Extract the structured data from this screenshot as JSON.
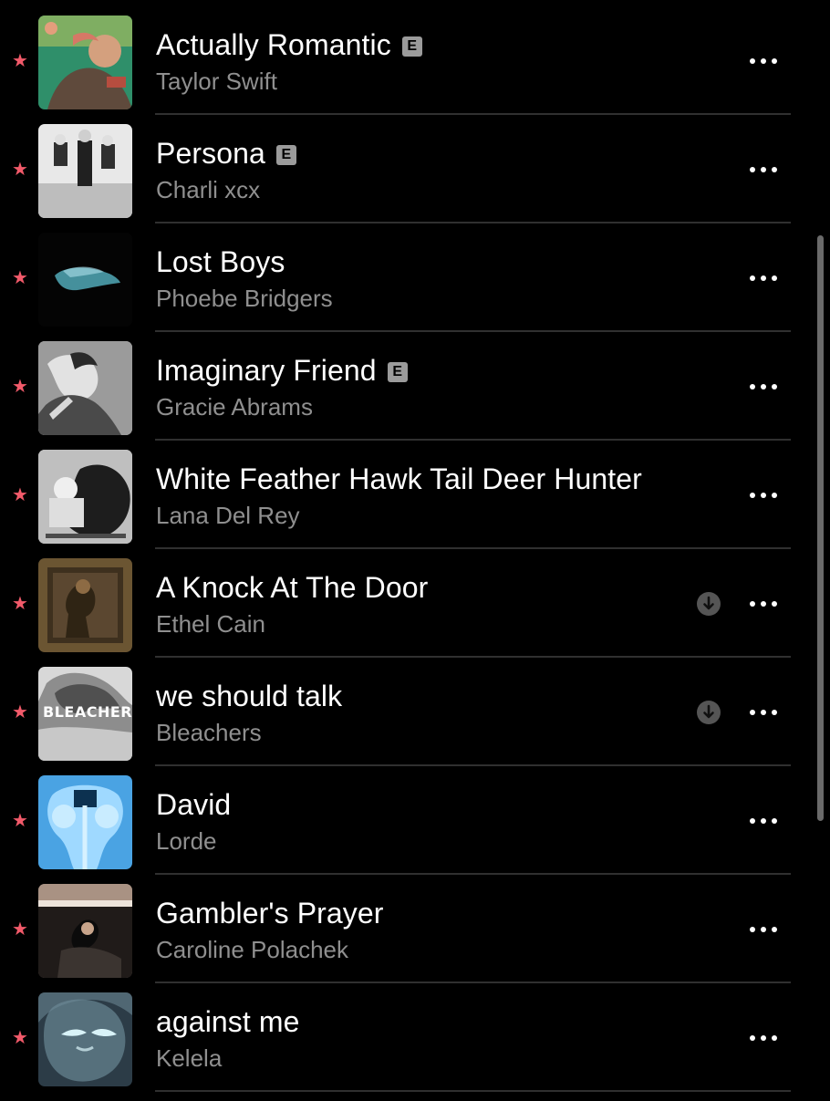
{
  "songs": [
    {
      "title": "Actually Romantic",
      "artist": "Taylor Swift",
      "explicit": true,
      "explicit_label": "E",
      "favorite": true,
      "downloaded": false,
      "art_colors": [
        "#2f8f6a",
        "#c9a07b"
      ]
    },
    {
      "title": "Persona",
      "artist": "Charli xcx",
      "explicit": true,
      "explicit_label": "E",
      "favorite": true,
      "downloaded": false,
      "art_colors": [
        "#e8e8e8",
        "#222222"
      ]
    },
    {
      "title": "Lost Boys",
      "artist": "Phoebe Bridgers",
      "explicit": false,
      "explicit_label": "",
      "favorite": true,
      "downloaded": false,
      "art_colors": [
        "#050505",
        "#5fc8d8"
      ]
    },
    {
      "title": "Imaginary Friend",
      "artist": "Gracie Abrams",
      "explicit": true,
      "explicit_label": "E",
      "favorite": true,
      "downloaded": false,
      "art_colors": [
        "#bdbdbd",
        "#3a3a3a"
      ]
    },
    {
      "title": "White Feather Hawk Tail Deer Hunter",
      "artist": "Lana Del Rey",
      "explicit": false,
      "explicit_label": "",
      "favorite": true,
      "downloaded": false,
      "art_colors": [
        "#d9d9d9",
        "#1f1f1f"
      ]
    },
    {
      "title": "A Knock At The Door",
      "artist": "Ethel Cain",
      "explicit": false,
      "explicit_label": "",
      "favorite": true,
      "downloaded": true,
      "art_colors": [
        "#6b5532",
        "#2f2414"
      ]
    },
    {
      "title": "we should talk",
      "artist": "Bleachers",
      "explicit": false,
      "explicit_label": "",
      "favorite": true,
      "downloaded": true,
      "art_colors": [
        "#d8d8d8",
        "#3a3a3a"
      ],
      "art_text": "BLEACHERS"
    },
    {
      "title": "David",
      "artist": "Lorde",
      "explicit": false,
      "explicit_label": "",
      "favorite": true,
      "downloaded": false,
      "art_colors": [
        "#4aa3e3",
        "#cfeeff"
      ]
    },
    {
      "title": "Gambler's Prayer",
      "artist": "Caroline Polachek",
      "explicit": false,
      "explicit_label": "",
      "favorite": true,
      "downloaded": false,
      "art_colors": [
        "#6c625b",
        "#201b19"
      ]
    },
    {
      "title": "against me",
      "artist": "Kelela",
      "explicit": false,
      "explicit_label": "",
      "favorite": true,
      "downloaded": false,
      "art_colors": [
        "#2c3c47",
        "#a9c7cf"
      ]
    }
  ],
  "icons": {
    "favorite": "star-icon",
    "download": "download-icon",
    "more": "more-icon"
  },
  "colors": {
    "background": "#000000",
    "accent": "#f25a6a",
    "title": "#ffffff",
    "subtitle": "#8f8f8f",
    "divider": "#303030"
  }
}
